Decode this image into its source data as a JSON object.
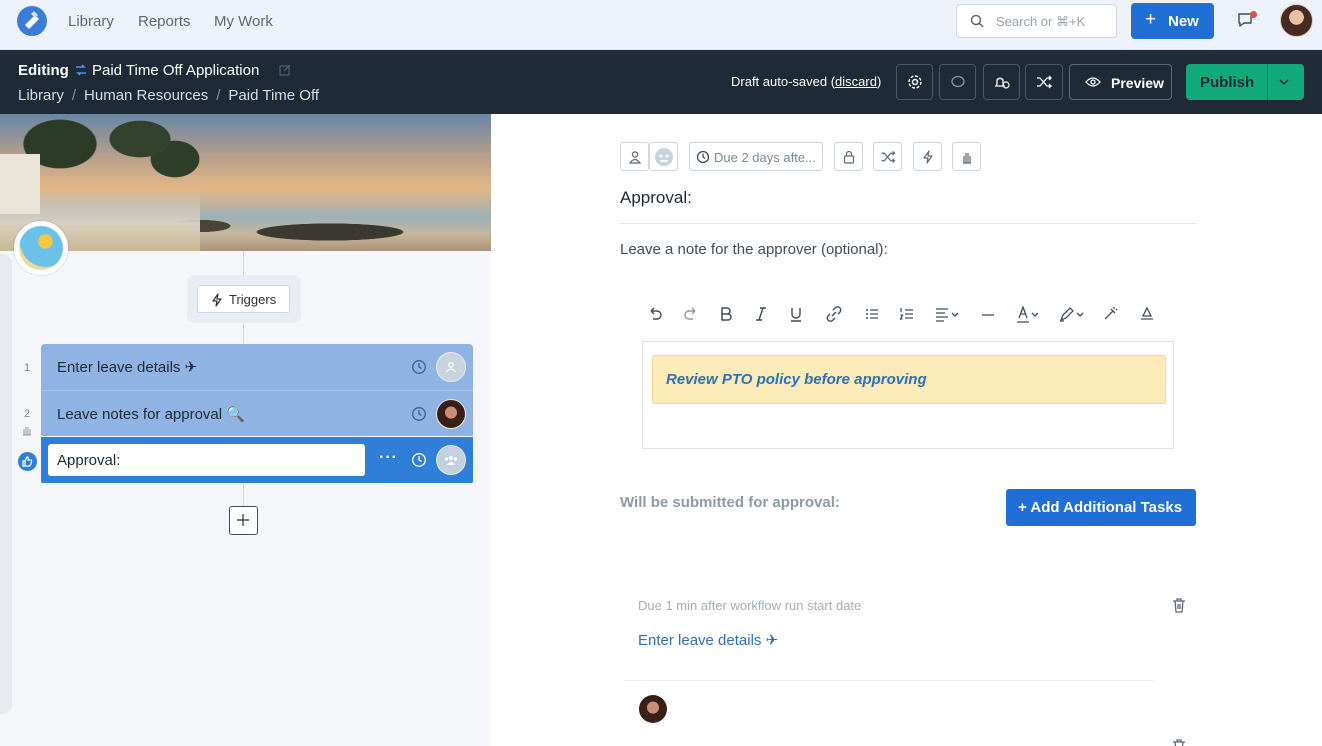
{
  "nav": {
    "links": [
      "Library",
      "Reports",
      "My Work"
    ],
    "search_placeholder": "Search or ⌘+K",
    "new_label": "New"
  },
  "header": {
    "editing_label": "Editing",
    "title": "Paid Time Off Application",
    "breadcrumbs": [
      "Library",
      "Human Resources",
      "Paid Time Off"
    ],
    "draft_text": "Draft auto-saved (",
    "discard_label": "discard",
    "draft_close": ")",
    "preview_label": "Preview",
    "publish_label": "Publish"
  },
  "workflow": {
    "triggers_label": "Triggers",
    "steps": [
      {
        "number": "1",
        "label": "Enter leave details ✈"
      },
      {
        "number": "2",
        "label": "Leave notes for approval 🔍"
      },
      {
        "number": "",
        "label": "Approval:"
      }
    ],
    "more_label": "···"
  },
  "detail": {
    "due_label": "Due 2 days afte...",
    "approval_title": "Approval:",
    "note_label": "Leave a note for the approver (optional):",
    "callout_text": "Review PTO policy before approving",
    "submitted_label": "Will be submitted for approval:",
    "add_tasks_label": "+ Add Additional Tasks",
    "task_due": "Due 1 min after workflow run start date",
    "task_link": "Enter leave details ✈"
  },
  "colors": {
    "primary": "#1f6fd4",
    "header_bg": "#1e2a36",
    "publish": "#12a97a",
    "callout_bg": "#fdecb9"
  }
}
